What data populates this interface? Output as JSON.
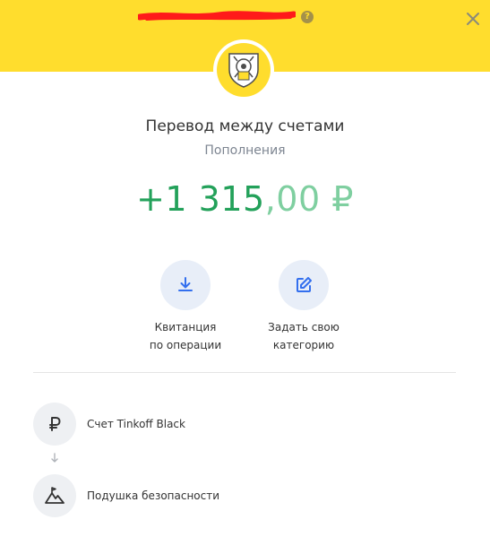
{
  "header": {
    "bg_color": "#ffdd2d",
    "help_icon": "question-circle-icon",
    "close_icon": "close-icon"
  },
  "operation": {
    "title": "Перевод между счетами",
    "category": "Пополнения",
    "amount_main": "+1 315",
    "amount_fraction": ",00 ₽",
    "amount_color": "#23a15a"
  },
  "actions": [
    {
      "label": "Квитанция\nпо операции",
      "icon": "download-icon"
    },
    {
      "label": "Задать свою\nкатегорию",
      "icon": "edit-icon"
    }
  ],
  "transfer": {
    "from": {
      "label": "Счет Tinkoff Black",
      "icon": "ruble-icon"
    },
    "to": {
      "label": "Подушка безопасности",
      "icon": "mountain-flag-icon"
    },
    "arrow_icon": "arrow-down-icon"
  }
}
